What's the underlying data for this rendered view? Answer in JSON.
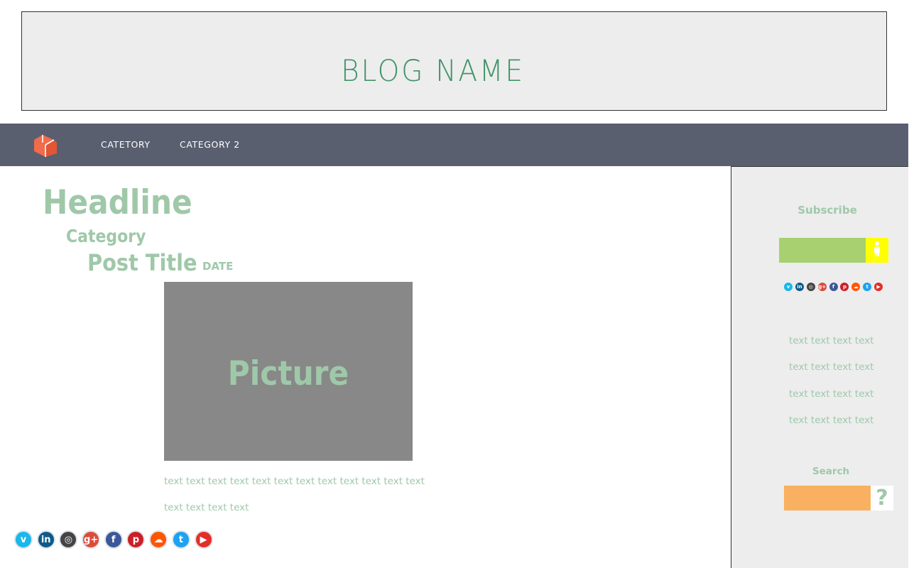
{
  "header": {
    "blog_name": "BLOG NAME"
  },
  "nav": {
    "logo_icon": "box-icon",
    "items": [
      {
        "label": "CATETORY"
      },
      {
        "label": "CATEGORY 2"
      }
    ]
  },
  "post": {
    "headline": "Headline",
    "category": "Category",
    "title": "Post Title",
    "date": "DATE",
    "picture_label": "Picture",
    "body_lines": [
      "text text text text text text text text text text text text",
      "text text text text"
    ]
  },
  "social": [
    {
      "name": "vimeo-icon",
      "glyph": "v",
      "color": "#1ab7ea"
    },
    {
      "name": "linkedin-icon",
      "glyph": "in",
      "color": "#0e5a8a"
    },
    {
      "name": "instagram-icon",
      "glyph": "◎",
      "color": "#444444"
    },
    {
      "name": "google-plus-icon",
      "glyph": "g+",
      "color": "#dd4b39"
    },
    {
      "name": "facebook-icon",
      "glyph": "f",
      "color": "#3b5998"
    },
    {
      "name": "pinterest-icon",
      "glyph": "p",
      "color": "#cb2027"
    },
    {
      "name": "soundcloud-icon",
      "glyph": "☁",
      "color": "#ff5500"
    },
    {
      "name": "twitter-icon",
      "glyph": "t",
      "color": "#1da1f2"
    },
    {
      "name": "youtube-icon",
      "glyph": "▶",
      "color": "#e52d27"
    }
  ],
  "sidebar": {
    "subscribe_label": "Subscribe",
    "subscribe_button_icon": "person-icon",
    "text_lines": [
      "text text text text",
      "text text text text",
      "text text text text",
      "text text text text"
    ],
    "search_label": "Search",
    "search_button_glyph": "?"
  },
  "colors": {
    "accent_green": "#9fc8a9",
    "brand_green": "#3f9468",
    "nav_bg": "#5a5f70",
    "logo_orange": "#f26b4a",
    "subscribe_green": "#a8d070",
    "subscribe_yellow": "#ffff00",
    "search_orange": "#f9b060",
    "picture_gray": "#888888"
  }
}
